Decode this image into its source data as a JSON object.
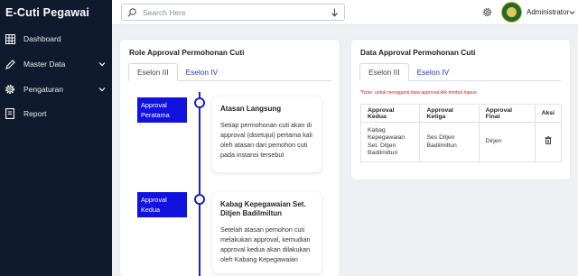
{
  "app": {
    "title": "E-Cuti Pegawai"
  },
  "sidebar": {
    "items": [
      {
        "label": "Dashboard",
        "icon": "dashboard-icon"
      },
      {
        "label": "Master Data",
        "icon": "pencil-icon",
        "has_submenu": true
      },
      {
        "label": "Pengaturan",
        "icon": "gear-icon",
        "has_submenu": true
      },
      {
        "label": "Report",
        "icon": "report-icon"
      }
    ]
  },
  "topbar": {
    "search_placeholder": "Search Here",
    "user_name": "Administrator"
  },
  "left_card": {
    "title": "Role Approval Permohonan Cuti",
    "tabs": [
      {
        "label": "Eselon III",
        "active": true
      },
      {
        "label": "Eselon IV",
        "active": false
      }
    ],
    "timeline": [
      {
        "badge": "Approval Peratama",
        "title": "Atasan Langsung",
        "description": "Setiap permohonan cuti akan di approval (disetujui) pertama kali oleh atasan dari pemohon cuti pada instansi tersebut"
      },
      {
        "badge": "Approval Kedua",
        "title": "Kabag Kepegawaian Set. Ditjen Badilmiltun",
        "description": "Setelah atasan pemohon cuti melakukan approval, kemudian approval kedua akan dilakukan oleh Kabang Kepegawaian"
      }
    ]
  },
  "right_card": {
    "title": "Data Approval Permohonan Cuti",
    "tabs": [
      {
        "label": "Eselon III",
        "active": true
      },
      {
        "label": "Eselon IV",
        "active": false
      }
    ],
    "note": "*Note: untuk mengganti data approval klik tombol hapus",
    "table": {
      "headers": [
        "Approval Kedua",
        "Approval Ketiga",
        "Approval Final",
        "Aksi"
      ],
      "rows": [
        [
          "Kabag Kepegawaian Set. Ditjen Badilmiltun",
          "Ses Ditjen Badilmiltun",
          "Dirjen",
          ""
        ]
      ]
    }
  },
  "colors": {
    "sidebar_bg": "#0f1a2e",
    "accent_blue": "#1212e0",
    "note_red": "#d01c1c"
  }
}
